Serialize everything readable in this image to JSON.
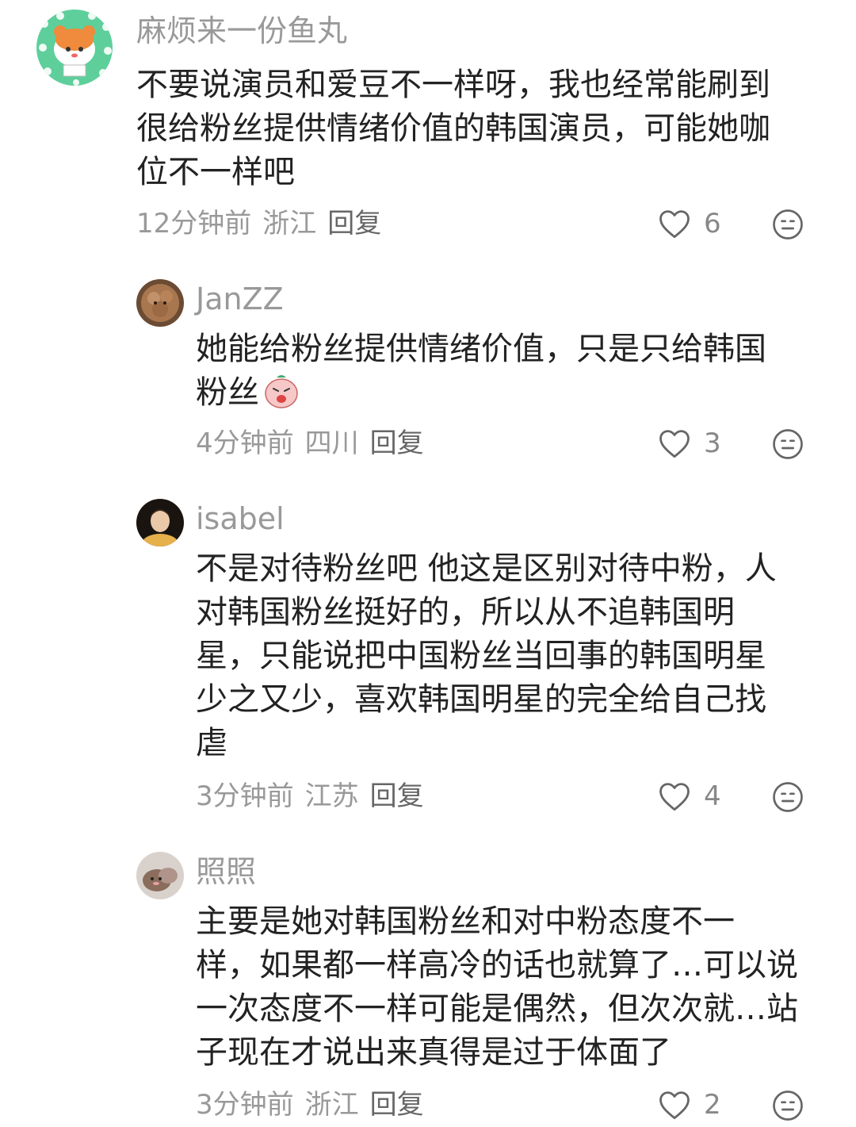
{
  "comments": [
    {
      "username": "麻烦来一份鱼丸",
      "lines": [
        "不要说演员和爱豆不一样呀，我也经常能刷到",
        "很给粉丝提供情绪价值的韩国演员，可能她咖",
        "位不一样吧"
      ],
      "time": "12分钟前",
      "location": "浙江",
      "reply_label": "回复",
      "likes": "6"
    },
    {
      "username": "JanZZ",
      "lines": [
        "她能给粉丝提供情绪价值，只是只给韩国",
        "粉丝"
      ],
      "time": "4分钟前",
      "location": "四川",
      "reply_label": "回复",
      "likes": "3"
    },
    {
      "username": "isabel",
      "lines": [
        "不是对待粉丝吧 他这是区别对待中粉，人",
        "对韩国粉丝挺好的，所以从不追韩国明",
        "星，只能说把中国粉丝当回事的韩国明星",
        "少之又少，喜欢韩国明星的完全给自己找",
        "虐"
      ],
      "time": "3分钟前",
      "location": "江苏",
      "reply_label": "回复",
      "likes": "4"
    },
    {
      "username": "照照",
      "lines": [
        "主要是她对韩国粉丝和对中粉态度不一",
        "样，如果都一样高冷的话也就算了…可以说",
        "一次态度不一样可能是偶然，但次次就…站",
        "子现在才说出来真得是过于体面了"
      ],
      "time": "3分钟前",
      "location": "浙江",
      "reply_label": "回复",
      "likes": "2"
    }
  ],
  "icons": {
    "like": "heart-outline-icon",
    "dislike": "meh-face-icon",
    "inline_emoji": "crying-sticker-emoji"
  },
  "colors": {
    "text": "#222222",
    "meta": "#999999",
    "icon": "#666666",
    "avatar1_bg": "#5ecf9b"
  }
}
